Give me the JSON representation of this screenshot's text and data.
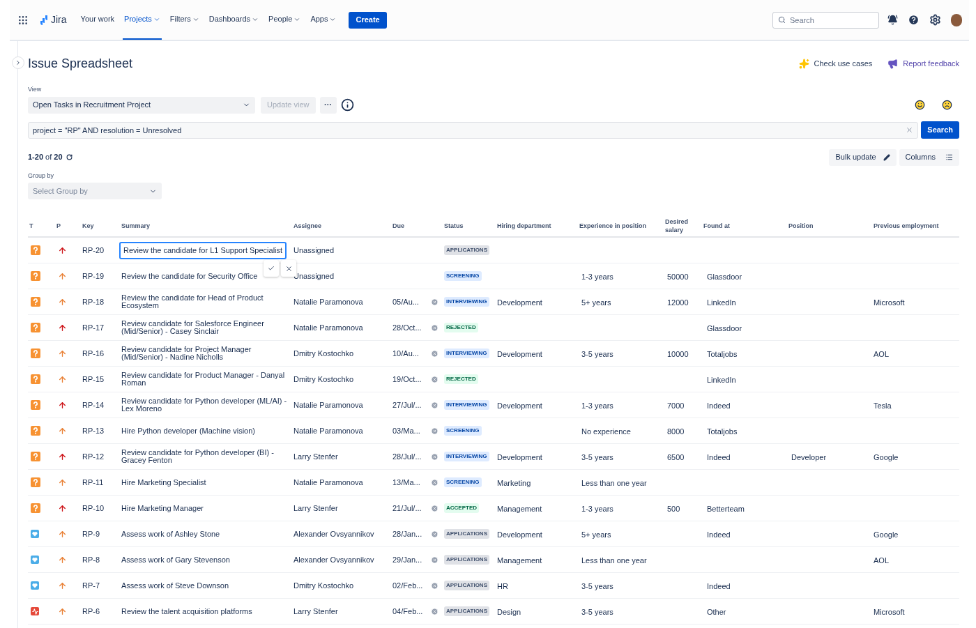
{
  "nav": {
    "product": "Jira",
    "items": [
      {
        "label": "Your work",
        "dropdown": false,
        "selected": false
      },
      {
        "label": "Projects",
        "dropdown": true,
        "selected": true
      },
      {
        "label": "Filters",
        "dropdown": true,
        "selected": false
      },
      {
        "label": "Dashboards",
        "dropdown": true,
        "selected": false
      },
      {
        "label": "People",
        "dropdown": true,
        "selected": false
      },
      {
        "label": "Apps",
        "dropdown": true,
        "selected": false
      }
    ],
    "create": "Create",
    "search_placeholder": "Search"
  },
  "page": {
    "title": "Issue Spreadsheet",
    "check_use_cases": "Check use cases",
    "report_feedback": "Report feedback"
  },
  "view": {
    "label": "View",
    "value": "Open Tasks in Recruitment Project",
    "update": "Update view",
    "more": "···"
  },
  "query": {
    "value": "project = \"RP\" AND resolution = Unresolved",
    "search": "Search"
  },
  "count": "**1-20** of **20**",
  "actions": {
    "bulk_update": "Bulk update",
    "columns": "Columns"
  },
  "group_by": {
    "label": "Group by",
    "placeholder": "Select Group by"
  },
  "table": {
    "columns": [
      "T",
      "P",
      "Key",
      "Summary",
      "Assignee",
      "Due",
      "Status",
      "Hiring department",
      "Experience in position",
      "Desired salary",
      "Found at",
      "Position",
      "Previous employment"
    ],
    "rows": [
      {
        "kind": "question",
        "priority": {
          "color": "#cd1317"
        },
        "key": "RP-20",
        "summary": "Review the candidate for L1 Support Specialist",
        "editing": true,
        "assignee": "Unassigned",
        "due": "",
        "status": {
          "label": "APPLICATIONS",
          "color": "#42526e"
        },
        "department": "",
        "experience": "",
        "salary": "",
        "found_at": "",
        "position": "",
        "previous": ""
      },
      {
        "kind": "question",
        "priority": {
          "color": "#e97f33"
        },
        "key": "RP-19",
        "summary": "Review the candidate for Security Office",
        "editing": false,
        "assignee": "Unassigned",
        "due": "",
        "status": {
          "label": "SCREENING",
          "color": "#0747a6"
        },
        "department": "",
        "experience": "1-3 years",
        "salary": "50000",
        "found_at": "Glassdoor",
        "position": "",
        "previous": ""
      },
      {
        "kind": "question",
        "priority": {
          "color": "#e97f33"
        },
        "key": "RP-18",
        "summary": "Review the candidate for Head of Product Ecosystem",
        "editing": false,
        "assignee": "Natalie Paramonova",
        "due": "05/Au...",
        "status": {
          "label": "INTERVIEWING",
          "color": "#0747a6"
        },
        "department": "Development",
        "experience": "5+ years",
        "salary": "12000",
        "found_at": "LinkedIn",
        "position": "",
        "previous": "Microsoft"
      },
      {
        "kind": "question",
        "priority": {
          "color": "#cd1317"
        },
        "key": "RP-17",
        "summary": "Review candidate for Salesforce Engineer (Mid/Senior) - Casey Sinclair",
        "editing": false,
        "assignee": "Natalie Paramonova",
        "due": "28/Oct...",
        "status": {
          "label": "REJECTED",
          "color": "#006644"
        },
        "department": "",
        "experience": "",
        "salary": "",
        "found_at": "Glassdoor",
        "position": "",
        "previous": ""
      },
      {
        "kind": "question",
        "priority": {
          "color": "#e97f33"
        },
        "key": "RP-16",
        "summary": "Review candidate for Project Manager (Mid/Senior) - Nadine Nicholls",
        "editing": false,
        "assignee": "Dmitry Kostochko",
        "due": "10/Au...",
        "status": {
          "label": "INTERVIEWING",
          "color": "#0747a6"
        },
        "department": "Development",
        "experience": "3-5 years",
        "salary": "10000",
        "found_at": "Totaljobs",
        "position": "",
        "previous": "AOL"
      },
      {
        "kind": "question",
        "priority": {
          "color": "#e97f33"
        },
        "key": "RP-15",
        "summary": "Review candidate for Product Manager - Danyal Roman",
        "editing": false,
        "assignee": "Dmitry Kostochko",
        "due": "19/Oct...",
        "status": {
          "label": "REJECTED",
          "color": "#006644"
        },
        "department": "",
        "experience": "",
        "salary": "",
        "found_at": "LinkedIn",
        "position": "",
        "previous": ""
      },
      {
        "kind": "question",
        "priority": {
          "color": "#cd1317"
        },
        "key": "RP-14",
        "summary": "Review candidate for Python developer (ML/AI) - Lex Moreno",
        "editing": false,
        "assignee": "Natalie Paramonova",
        "due": "27/Jul/...",
        "status": {
          "label": "INTERVIEWING",
          "color": "#0747a6"
        },
        "department": "Development",
        "experience": "1-3 years",
        "salary": "7000",
        "found_at": "Indeed",
        "position": "",
        "previous": "Tesla"
      },
      {
        "kind": "question",
        "priority": {
          "color": "#e97f33"
        },
        "key": "RP-13",
        "summary": "Hire Python developer (Machine vision)",
        "editing": false,
        "assignee": "Natalie Paramonova",
        "due": "03/Ma...",
        "status": {
          "label": "SCREENING",
          "color": "#0747a6"
        },
        "department": "",
        "experience": "No experience",
        "salary": "8000",
        "found_at": "Totaljobs",
        "position": "",
        "previous": ""
      },
      {
        "kind": "question",
        "priority": {
          "color": "#cd1317"
        },
        "key": "RP-12",
        "summary": "Review candidate for Python developer (BI) - Gracey Fenton",
        "editing": false,
        "assignee": "Larry Stenfer",
        "due": "28/Jul/...",
        "status": {
          "label": "INTERVIEWING",
          "color": "#0747a6"
        },
        "department": "Development",
        "experience": "3-5 years",
        "salary": "6500",
        "found_at": "Indeed",
        "position": "Developer",
        "previous": "Google"
      },
      {
        "kind": "question",
        "priority": {
          "color": "#e97f33"
        },
        "key": "RP-11",
        "summary": "Hire Marketing Specialist",
        "editing": false,
        "assignee": "Natalie Paramonova",
        "due": "13/Ma...",
        "status": {
          "label": "SCREENING",
          "color": "#0747a6"
        },
        "department": "Marketing",
        "experience": "Less than one year",
        "salary": "",
        "found_at": "",
        "position": "",
        "previous": ""
      },
      {
        "kind": "question",
        "priority": {
          "color": "#cd1317"
        },
        "key": "RP-10",
        "summary": "Hire Marketing Manager",
        "editing": false,
        "assignee": "Larry Stenfer",
        "due": "21/Jul/...",
        "status": {
          "label": "ACCEPTED",
          "color": "#006644"
        },
        "department": "Management",
        "experience": "1-3 years",
        "salary": "500",
        "found_at": "Betterteam",
        "position": "",
        "previous": ""
      },
      {
        "kind": "feedback",
        "priority": {
          "color": "#e97f33"
        },
        "key": "RP-9",
        "summary": "Assess work of Ashley Stone",
        "editing": false,
        "assignee": "Alexander Ovsyannikov",
        "due": "28/Jan...",
        "status": {
          "label": "APPLICATIONS",
          "color": "#42526e"
        },
        "department": "Development",
        "experience": "5+ years",
        "salary": "",
        "found_at": "Indeed",
        "position": "",
        "previous": "Google"
      },
      {
        "kind": "feedback",
        "priority": {
          "color": "#e97f33"
        },
        "key": "RP-8",
        "summary": "Assess work of Gary Stevenson",
        "editing": false,
        "assignee": "Alexander Ovsyannikov",
        "due": "29/Jan...",
        "status": {
          "label": "APPLICATIONS",
          "color": "#42526e"
        },
        "department": "Management",
        "experience": "Less than one year",
        "salary": "",
        "found_at": "",
        "position": "",
        "previous": "AOL"
      },
      {
        "kind": "feedback",
        "priority": {
          "color": "#e97f33"
        },
        "key": "RP-7",
        "summary": "Assess work of Steve Downson",
        "editing": false,
        "assignee": "Dmitry Kostochko",
        "due": "02/Feb...",
        "status": {
          "label": "APPLICATIONS",
          "color": "#42526e"
        },
        "department": "HR",
        "experience": "3-5 years",
        "salary": "",
        "found_at": "Indeed",
        "position": "",
        "previous": ""
      },
      {
        "kind": "pulse",
        "priority": {
          "color": "#e97f33"
        },
        "key": "RP-6",
        "summary": "Review the talent acquisition platforms",
        "editing": false,
        "assignee": "Larry Stenfer",
        "due": "04/Feb...",
        "status": {
          "label": "APPLICATIONS",
          "color": "#42526e"
        },
        "department": "Design",
        "experience": "3-5 years",
        "salary": "",
        "found_at": "Other",
        "position": "",
        "previous": "Microsoft"
      }
    ]
  }
}
